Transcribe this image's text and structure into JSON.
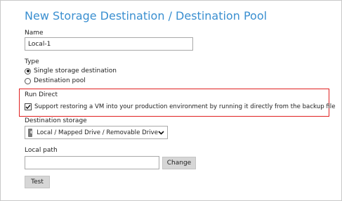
{
  "dialog": {
    "title": "New Storage Destination / Destination Pool"
  },
  "name_field": {
    "label": "Name",
    "value": "Local-1"
  },
  "type": {
    "label": "Type",
    "options": [
      {
        "label": "Single storage destination",
        "selected": true
      },
      {
        "label": "Destination pool",
        "selected": false
      }
    ]
  },
  "run_direct": {
    "label": "Run Direct",
    "checkbox_label": "Support restoring a VM into your production environment by running it directly from the backup file",
    "checked": true,
    "highlight_color": "#e02020"
  },
  "destination_storage": {
    "label": "Destination storage",
    "selected": "Local / Mapped Drive / Removable Drive",
    "icon": "drive-icon"
  },
  "local_path": {
    "label": "Local path",
    "value": "",
    "change_label": "Change"
  },
  "test_button": {
    "label": "Test"
  },
  "colors": {
    "title": "#3a8fd0",
    "button_bg": "#d6d6d6"
  }
}
